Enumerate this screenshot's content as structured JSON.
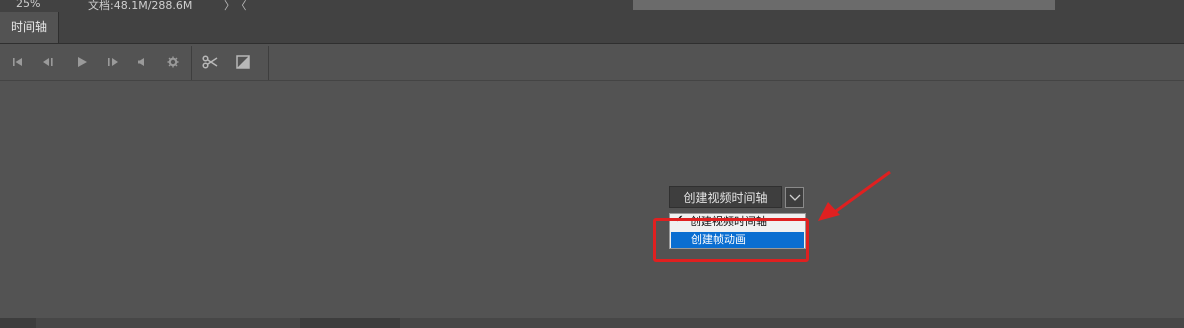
{
  "status": {
    "zoom": "25%",
    "document": "文档:48.1M/288.6M",
    "nav": "〉〈"
  },
  "panel": {
    "tab_label": "时间轴"
  },
  "toolbar": {
    "icons": [
      "go-to-first-frame-icon",
      "previous-frame-icon",
      "play-icon",
      "next-frame-icon",
      "audio-icon",
      "settings-icon",
      "split-scissors-icon",
      "transition-icon"
    ]
  },
  "dropdown": {
    "selected": "创建视频时间轴",
    "options": [
      {
        "label": "创建视频时间轴",
        "checked": true
      },
      {
        "label": "创建帧动画",
        "highlighted": true
      }
    ]
  },
  "annotation": {
    "color": "#e02020"
  },
  "colors": {
    "panel_bg": "#535353",
    "tab_bar": "#424242",
    "menu_highlight": "#0a6ed1"
  }
}
